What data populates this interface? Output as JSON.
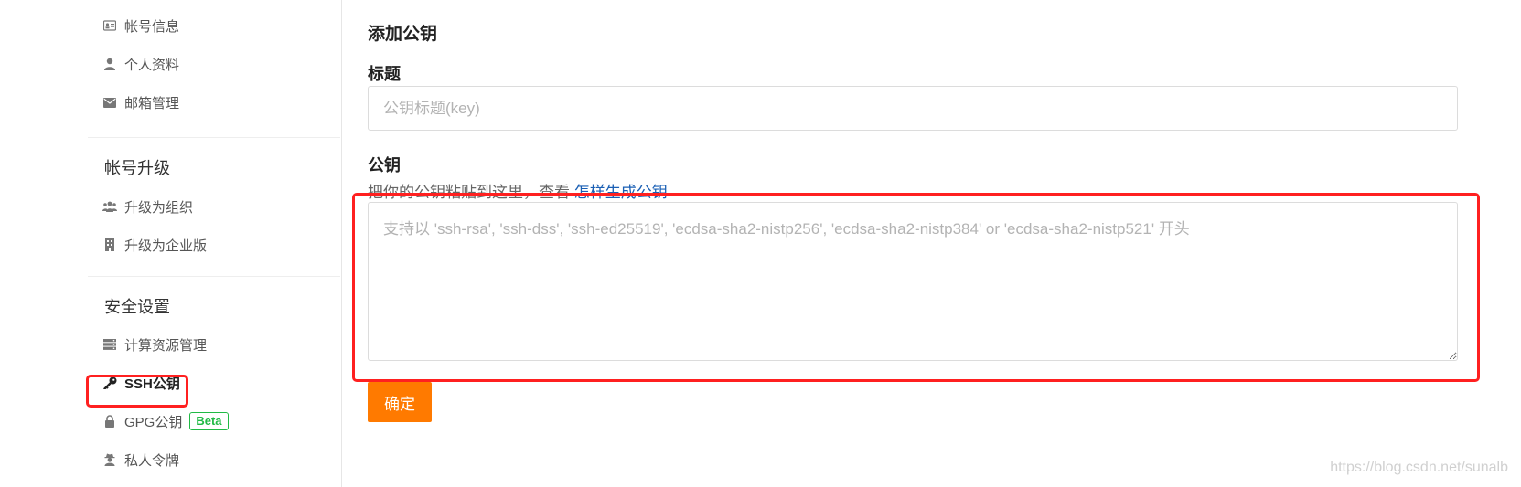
{
  "sidebar": {
    "account_items": [
      {
        "label": "帐号信息",
        "icon": "id-card-icon"
      },
      {
        "label": "个人资料",
        "icon": "user-icon"
      },
      {
        "label": "邮箱管理",
        "icon": "envelope-icon"
      }
    ],
    "upgrade_section": {
      "title": "帐号升级",
      "items": [
        {
          "label": "升级为组织",
          "icon": "users-icon"
        },
        {
          "label": "升级为企业版",
          "icon": "building-icon"
        }
      ]
    },
    "security_section": {
      "title": "安全设置",
      "items": [
        {
          "label": "计算资源管理",
          "icon": "server-icon"
        },
        {
          "label": "SSH公钥",
          "icon": "key-icon",
          "active": true
        },
        {
          "label": "GPG公钥",
          "icon": "lock-icon",
          "badge": "Beta"
        },
        {
          "label": "私人令牌",
          "icon": "user-secret-icon"
        }
      ]
    }
  },
  "form": {
    "heading": "添加公钥",
    "title_label": "标题",
    "title_placeholder": "公钥标题(key)",
    "key_label": "公钥",
    "key_help": "把你的公钥粘贴到这里，查看",
    "key_help_link": "怎样生成公钥",
    "key_placeholder": "支持以 'ssh-rsa', 'ssh-dss', 'ssh-ed25519', 'ecdsa-sha2-nistp256', 'ecdsa-sha2-nistp384' or 'ecdsa-sha2-nistp521' 开头",
    "submit_label": "确定"
  },
  "watermark": "https://blog.csdn.net/sunalb",
  "colors": {
    "accent": "#ff7a00",
    "highlight": "#ff2020",
    "link": "#1a5fb4",
    "badge": "#21ba45"
  }
}
